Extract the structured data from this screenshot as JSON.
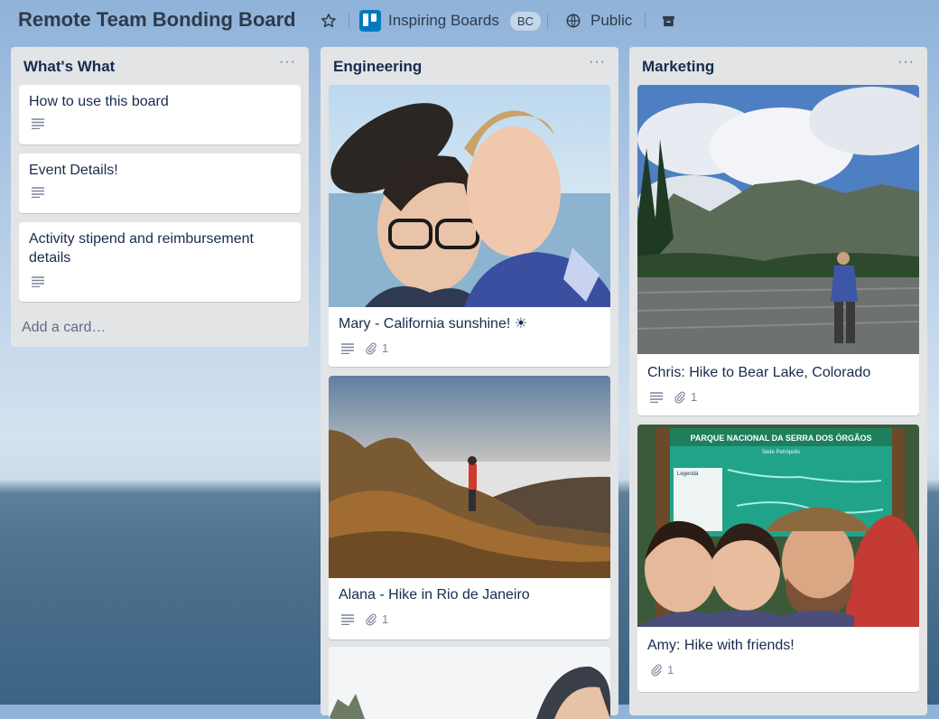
{
  "board": {
    "title": "Remote Team Bonding Board",
    "team_name": "Inspiring Boards",
    "team_badge": "BC",
    "visibility": "Public"
  },
  "lists": [
    {
      "title": "What's What",
      "menu": "···",
      "cards": [
        {
          "title": "How to use this board"
        },
        {
          "title": "Event Details!"
        },
        {
          "title": "Activity stipend and reimbursement details"
        }
      ],
      "add_card": "Add a card…"
    },
    {
      "title": "Engineering",
      "menu": "···",
      "cards": [
        {
          "title": "Mary - California sunshine! ☀",
          "attachments": "1"
        },
        {
          "title": "Alana - Hike in Rio de Janeiro",
          "attachments": "1"
        }
      ]
    },
    {
      "title": "Marketing",
      "menu": "···",
      "cards": [
        {
          "title": "Chris: Hike to Bear Lake, Colorado",
          "attachments": "1"
        },
        {
          "title": "Amy: Hike with friends!",
          "attachments": "1"
        },
        {
          "cover_sign": {
            "title": "PARQUE NACIONAL DA SERRA DOS ÓRGÃOS",
            "subtitle": "Sede Petrópolis",
            "legend": "Legenda"
          }
        }
      ]
    }
  ]
}
